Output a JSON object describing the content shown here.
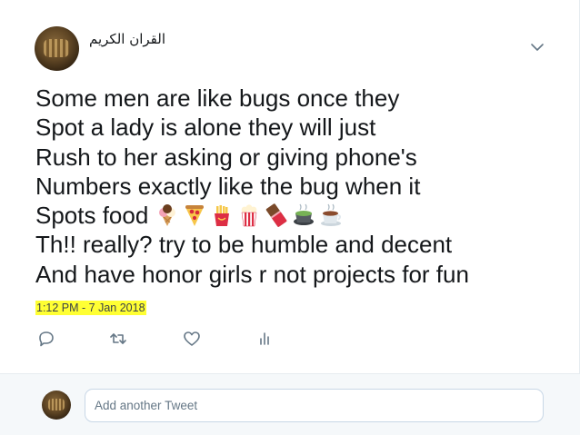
{
  "tweet": {
    "author_name": "القران الكريم",
    "avatar_icon": "quran-book-avatar",
    "menu_icon": "chevron-down-icon",
    "lines": [
      "Some men are like bugs once they",
      "Spot a lady is alone they will just",
      "Rush to her asking or giving phone's",
      "Numbers exactly like the bug when it",
      "Spots food",
      "Th!! really? try to be humble and decent",
      "And have honor girls r not projects for fun"
    ],
    "emojis": [
      "ice-cream",
      "pizza",
      "french-fries",
      "popcorn",
      "chocolate-bar",
      "green-tea",
      "hot-beverage"
    ],
    "timestamp": "1:12 PM - 7 Jan 2018",
    "highlight_color": "#ffff33",
    "actions": [
      "reply-icon",
      "retweet-icon",
      "like-icon",
      "analytics-icon"
    ]
  },
  "reply": {
    "placeholder": "Add another Tweet"
  },
  "colors": {
    "text": "#14171a",
    "icon": "#657786",
    "reply_bg": "#f5f8fa"
  }
}
